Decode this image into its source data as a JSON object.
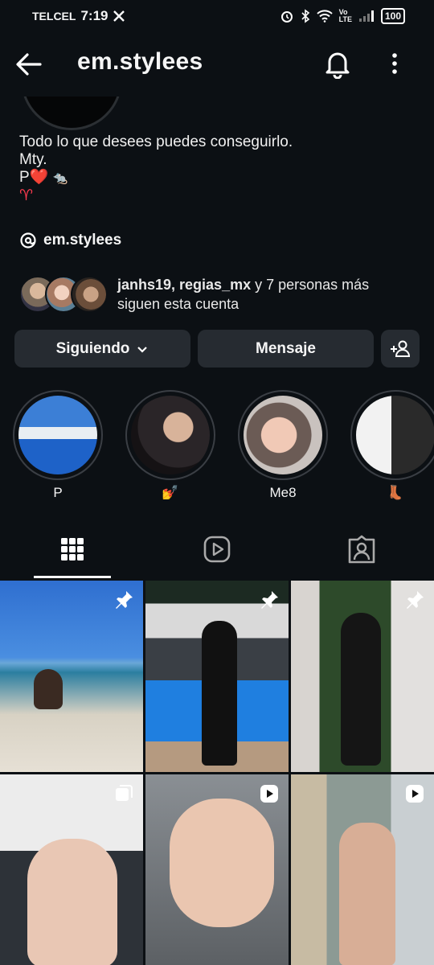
{
  "status_bar": {
    "carrier": "TELCEL",
    "time": "7:19",
    "battery": "100"
  },
  "header": {
    "username": "em.stylees"
  },
  "bio": {
    "line1": "Todo lo que desees puedes conseguirlo.",
    "line2": "Mty.",
    "line3": "P❤️",
    "line4": "♈"
  },
  "threads_handle": "em.stylees",
  "followers": {
    "names": "janhs19, regias_mx",
    "rest": " y 7 personas más",
    "line2": "siguen esta cuenta"
  },
  "buttons": {
    "following": "Siguiendo",
    "message": "Mensaje"
  },
  "highlights": [
    {
      "label": "P"
    },
    {
      "label": "💅"
    },
    {
      "label": "Me8"
    },
    {
      "label": "👢"
    }
  ],
  "tabs": [
    "grid-icon",
    "reels-icon",
    "tagged-icon"
  ],
  "posts": [
    {
      "badge": "pin-icon"
    },
    {
      "badge": "pin-icon"
    },
    {
      "badge": "pin-icon"
    },
    {
      "badge": "carousel-icon"
    },
    {
      "badge": "reel-icon"
    },
    {
      "badge": "reel-icon"
    }
  ]
}
